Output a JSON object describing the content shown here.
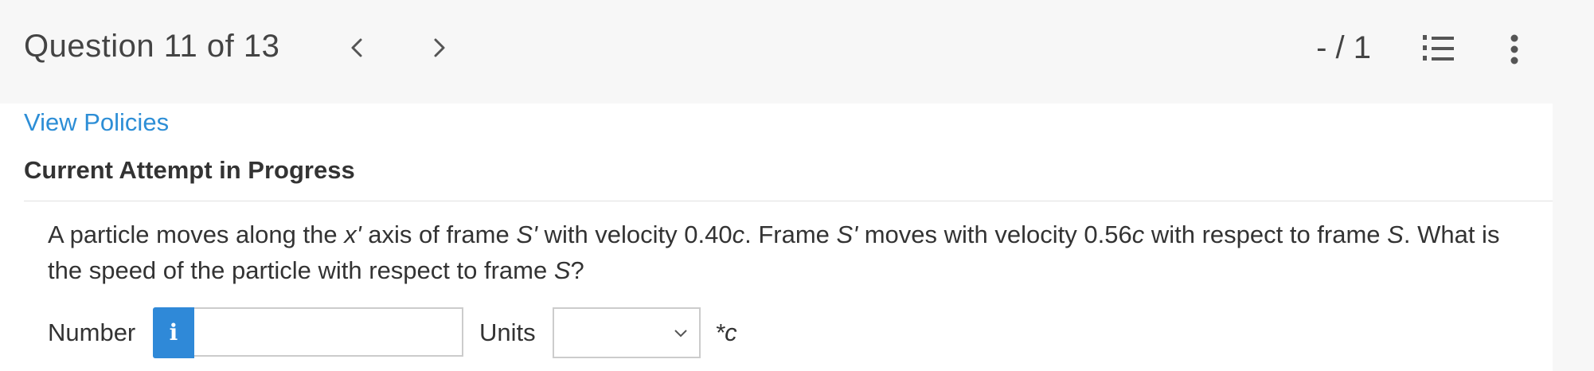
{
  "header": {
    "question_title": "Question 11 of 13",
    "score": "- / 1"
  },
  "content": {
    "view_policies": "View Policies",
    "attempt_status": "Current Attempt in Progress",
    "question": {
      "p1": "A particle moves along the ",
      "x_prime": "x'",
      "p2": " axis of frame ",
      "s_prime_1": "S'",
      "p3": " with velocity 0.40",
      "c1": "c",
      "p4": ". Frame ",
      "s_prime_2": "S'",
      "p5": " moves with velocity 0.56",
      "c2": "c",
      "p6": " with respect to frame ",
      "s1": "S",
      "p7": ". What is the speed of the particle with respect to frame ",
      "s2": "S",
      "p8": "?"
    },
    "answer": {
      "number_label": "Number",
      "info_icon": "i",
      "number_value": "",
      "units_label": "Units",
      "units_selected": "",
      "suffix": "*c"
    }
  },
  "colors": {
    "link": "#2d8ed6",
    "info_button": "#2f89d8",
    "header_bg": "#f7f7f7"
  },
  "icons": {
    "prev": "chevron-left-icon",
    "next": "chevron-right-icon",
    "list": "numbered-list-icon",
    "more": "more-vertical-icon",
    "units_dropdown": "chevron-down-icon"
  }
}
